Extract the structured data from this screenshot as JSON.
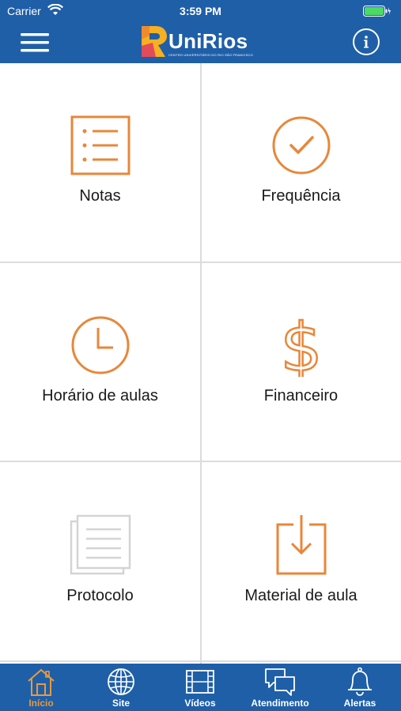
{
  "status_bar": {
    "carrier": "Carrier",
    "time": "3:59 PM"
  },
  "header": {
    "logo_text": "UniRios",
    "logo_tagline": "CENTRO UNIVERSITÁRIO DO RIO SÃO FRANCISCO",
    "menu_icon": "hamburger-icon",
    "info_icon": "info-icon"
  },
  "tiles": [
    {
      "label": "Notas",
      "icon": "list-icon",
      "color": "#e8873a"
    },
    {
      "label": "Frequência",
      "icon": "check-circle-icon",
      "color": "#e8873a"
    },
    {
      "label": "Horário de aulas",
      "icon": "clock-icon",
      "color": "#e8873a"
    },
    {
      "label": "Financeiro",
      "icon": "dollar-icon",
      "color": "#e8873a"
    },
    {
      "label": "Protocolo",
      "icon": "documents-icon",
      "color": "#d4d4d4"
    },
    {
      "label": "Material de aula",
      "icon": "download-box-icon",
      "color": "#e8873a"
    }
  ],
  "tab_bar": {
    "items": [
      {
        "label": "Início",
        "icon": "home-icon",
        "active": true
      },
      {
        "label": "Site",
        "icon": "globe-icon",
        "active": false
      },
      {
        "label": "Vídeos",
        "icon": "film-icon",
        "active": false
      },
      {
        "label": "Atendimento",
        "icon": "chat-icon",
        "active": false
      },
      {
        "label": "Alertas",
        "icon": "bell-icon",
        "active": false
      }
    ]
  },
  "colors": {
    "brand_blue": "#1f5fa8",
    "accent_orange": "#e8873a",
    "active_tab": "#e89a3c",
    "disabled_gray": "#d4d4d4"
  }
}
